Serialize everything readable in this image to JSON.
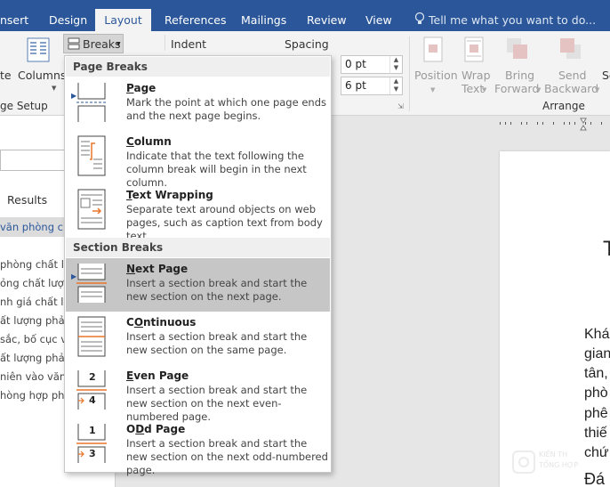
{
  "tabs": {
    "insert": "nsert",
    "design": "Design",
    "layout": "Layout",
    "references": "References",
    "mailings": "Mailings",
    "review": "Review",
    "view": "View",
    "tell_me": "Tell me what you want to do..."
  },
  "ribbon": {
    "orientation_partial": "te",
    "columns": "Columns",
    "breaks": "Breaks",
    "indent": "Indent",
    "spacing": "Spacing",
    "spacing_before": "0 pt",
    "spacing_after": "6 pt",
    "page_setup_group": "ge Setup",
    "position": "Position",
    "wrap_text": [
      "Wrap",
      "Text"
    ],
    "bring_forward": [
      "Bring",
      "Forward"
    ],
    "send_backward": [
      "Send",
      "Backward"
    ],
    "select_partial": "Se",
    "arrange_group": "Arrange"
  },
  "nav": {
    "results_tab": "Results",
    "items": [
      "văn phòng c",
      "phòng chất l",
      "ỏng chất lượn",
      "nh giá chất lư",
      "ất lượng phải",
      "sắc, bố cục và",
      "ất lượng phải",
      "niên vào văn p",
      "hòng hợp phé"
    ]
  },
  "document": {
    "heading_partial": "T",
    "lines": [
      "Khá",
      "gian",
      "tân,",
      "phò",
      "phê",
      "thiế",
      "chứ"
    ],
    "bottom_partial": "Đá",
    "watermark": [
      "KIẾN TH",
      "TỔNG HỢP"
    ]
  },
  "menu": {
    "page_breaks_header": "Page Breaks",
    "section_breaks_header": "Section Breaks",
    "items": [
      {
        "title": "Page",
        "ul": "P",
        "rest": "age",
        "desc": "Mark the point at which one page ends and the next page begins."
      },
      {
        "title": "Column",
        "ul": "C",
        "rest": "olumn",
        "desc": "Indicate that the text following the column break will begin in the next column."
      },
      {
        "title": "Text Wrapping",
        "ul": "T",
        "rest": "ext Wrapping",
        "desc": "Separate text around objects on web pages, such as caption text from body text."
      },
      {
        "title": "Next Page",
        "ul": "N",
        "rest": "ext Page",
        "desc": "Insert a section break and start the new section on the next page."
      },
      {
        "title": "Continuous",
        "ul": "O",
        "rest": "ntinuous",
        "pre": "C",
        "desc": "Insert a section break and start the new section on the same page."
      },
      {
        "title": "Even Page",
        "ul": "E",
        "rest": "ven Page",
        "desc": "Insert a section break and start the new section on the next even-numbered page."
      },
      {
        "title": "Odd Page",
        "ul": "D",
        "rest": "d Page",
        "pre": "O",
        "desc": "Insert a section break and start the new section on the next odd-numbered page."
      }
    ],
    "even_icon_numbers": [
      "2",
      "4"
    ],
    "odd_icon_numbers": [
      "1",
      "3"
    ]
  },
  "colors": {
    "accent": "#2b579a",
    "selected": "#c6c6c6",
    "icon_orange": "#e8762b"
  }
}
